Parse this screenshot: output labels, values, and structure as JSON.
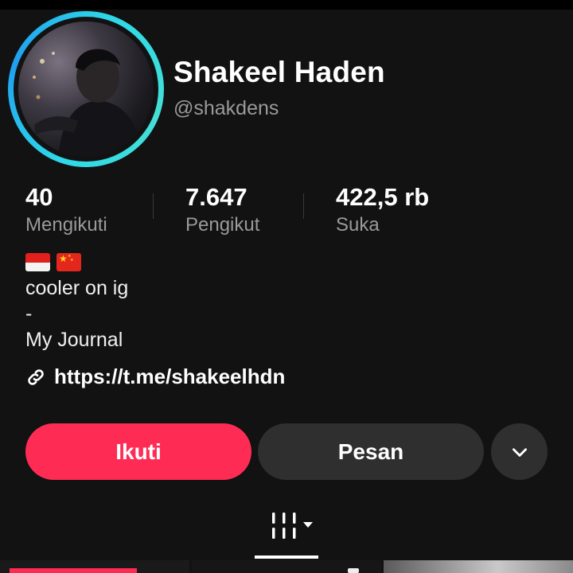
{
  "profile": {
    "name": "Shakeel Haden",
    "handle": "@shakdens"
  },
  "stats": [
    {
      "value": "40",
      "label": "Mengikuti"
    },
    {
      "value": "7.647",
      "label": "Pengikut"
    },
    {
      "value": "422,5 rb",
      "label": "Suka"
    }
  ],
  "bio": {
    "flags": [
      "indonesia-flag",
      "china-flag"
    ],
    "lines": [
      "cooler on ig",
      "-",
      "My Journal"
    ],
    "link_text": "https://t.me/shakeelhdn"
  },
  "actions": {
    "follow_label": "Ikuti",
    "message_label": "Pesan",
    "more_icon": "chevron-down-icon"
  },
  "tabs": {
    "grid_icon": "videos-grid-icon",
    "dropdown_icon": "caret-down-icon"
  },
  "colors": {
    "background": "#121212",
    "follow_button": "#fe2c55",
    "secondary_button": "#2f2f2f",
    "ring": "#2fd8e8",
    "muted_text": "#9a9a9a"
  }
}
